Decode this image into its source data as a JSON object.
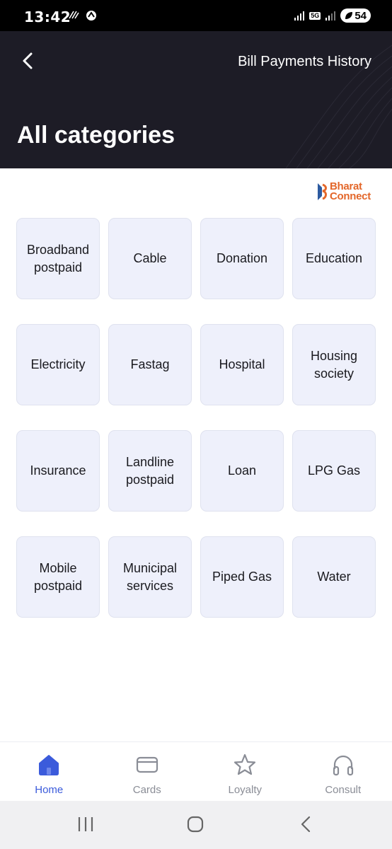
{
  "status_bar": {
    "time": "13:42",
    "network_label": "5G",
    "battery_level": "54"
  },
  "header": {
    "history_link": "Bill Payments History",
    "title": "All categories"
  },
  "logo": {
    "line1": "Bharat",
    "line2": "Connect"
  },
  "categories": [
    "Broadband postpaid",
    "Cable",
    "Donation",
    "Education",
    "Electricity",
    "Fastag",
    "Hospital",
    "Housing society",
    "Insurance",
    "Landline postpaid",
    "Loan",
    "LPG Gas",
    "Mobile postpaid",
    "Municipal services",
    "Piped Gas",
    "Water"
  ],
  "bottom_nav": {
    "active": "Home",
    "items": [
      {
        "label": "Home",
        "icon": "home-icon"
      },
      {
        "label": "Cards",
        "icon": "card-icon"
      },
      {
        "label": "Loyalty",
        "icon": "star-icon"
      },
      {
        "label": "Consult",
        "icon": "headphones-icon"
      }
    ]
  },
  "colors": {
    "header_bg": "#1d1c26",
    "tile_bg": "#eef0fb",
    "accent": "#3b5bdb",
    "logo_orange": "#e3672a",
    "logo_blue": "#2c5aa0"
  }
}
